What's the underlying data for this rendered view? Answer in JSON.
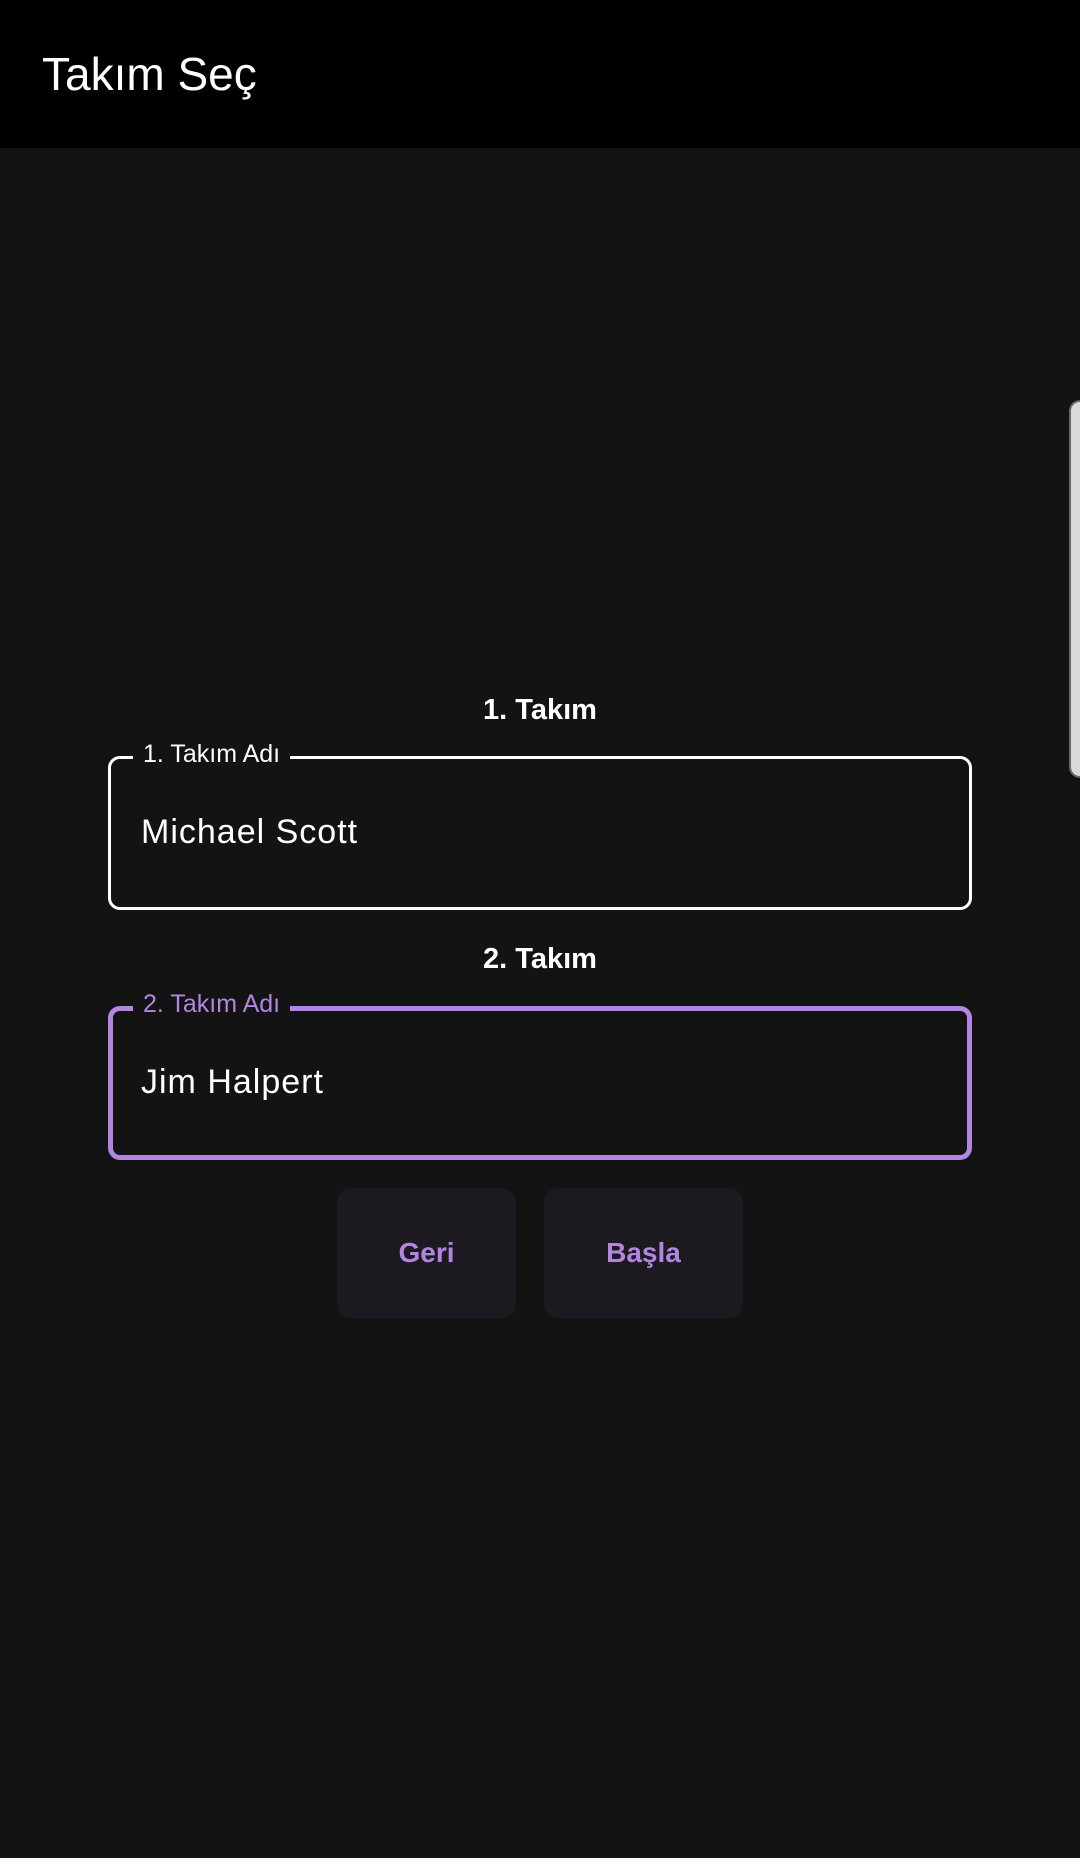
{
  "app_bar": {
    "title": "Takım Seç"
  },
  "team1": {
    "heading": "1. Takım",
    "field_label": "1. Takım Adı",
    "value": "Michael Scott"
  },
  "team2": {
    "heading": "2. Takım",
    "field_label": "2. Takım Adı",
    "value": "Jim Halpert",
    "focused": true
  },
  "actions": {
    "back_label": "Geri",
    "start_label": "Başla"
  },
  "colors": {
    "background": "#131313",
    "app_bar": "#000000",
    "accent": "#b285e0",
    "button_bg": "#1c1a20",
    "text": "#ffffff"
  }
}
